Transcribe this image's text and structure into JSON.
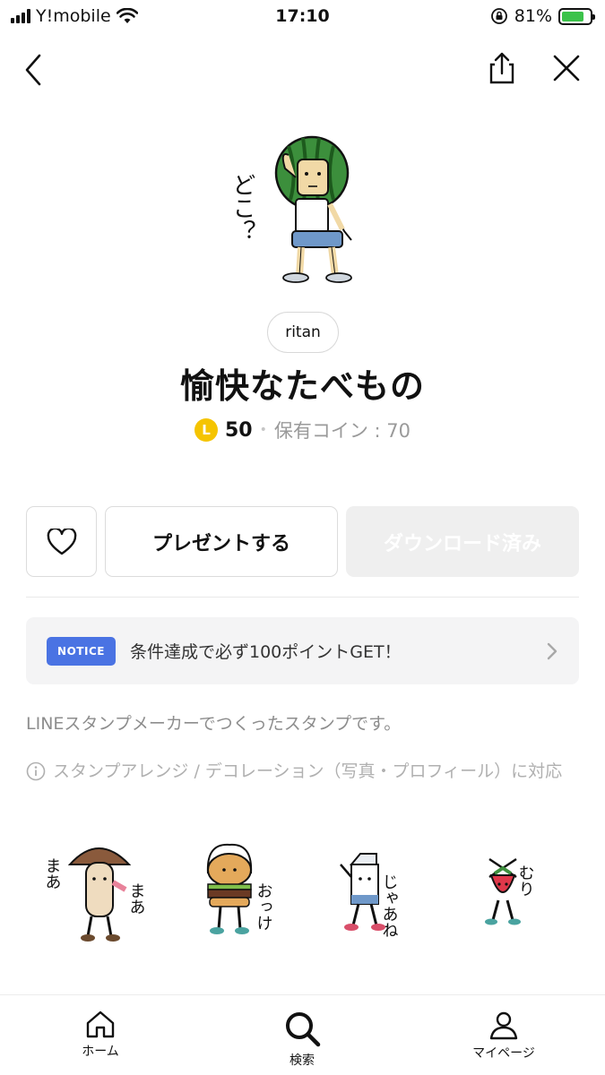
{
  "status_bar": {
    "carrier": "Y!mobile",
    "time": "17:10",
    "battery": "81%",
    "battery_level": 0.81
  },
  "nav": {
    "back_icon": "chevron-left-icon",
    "share_icon": "share-icon",
    "close_icon": "close-icon"
  },
  "product": {
    "author": "ritan",
    "title": "愉快なたべもの",
    "coin_symbol": "L",
    "price": "50",
    "owned_coins": "保有コイン : 70"
  },
  "hero_sticker": {
    "caption": "どこ？"
  },
  "actions": {
    "like_icon": "heart-icon",
    "gift_label": "プレゼントする",
    "download_label": "ダウンロード済み"
  },
  "notice": {
    "badge": "NOTICE",
    "text": "条件達成で必ず100ポイントGET！"
  },
  "description": "LINEスタンプメーカーでつくったスタンプです。",
  "compatibility": "スタンプアレンジ / デコレーション（写真・プロフィール）に対応",
  "stickers": [
    {
      "caption_left": "まあ",
      "caption_right": "まあ"
    },
    {
      "caption": "おっけ"
    },
    {
      "caption": "じゃあね"
    },
    {
      "caption": "むり"
    }
  ],
  "tabbar": [
    {
      "label": "ホーム",
      "icon": "home-icon"
    },
    {
      "label": "検索",
      "icon": "search-icon"
    },
    {
      "label": "マイページ",
      "icon": "person-icon"
    }
  ],
  "colors": {
    "accent_blue": "#4a73e3",
    "coin_yellow": "#f5c400",
    "battery_green": "#3bc24a"
  }
}
